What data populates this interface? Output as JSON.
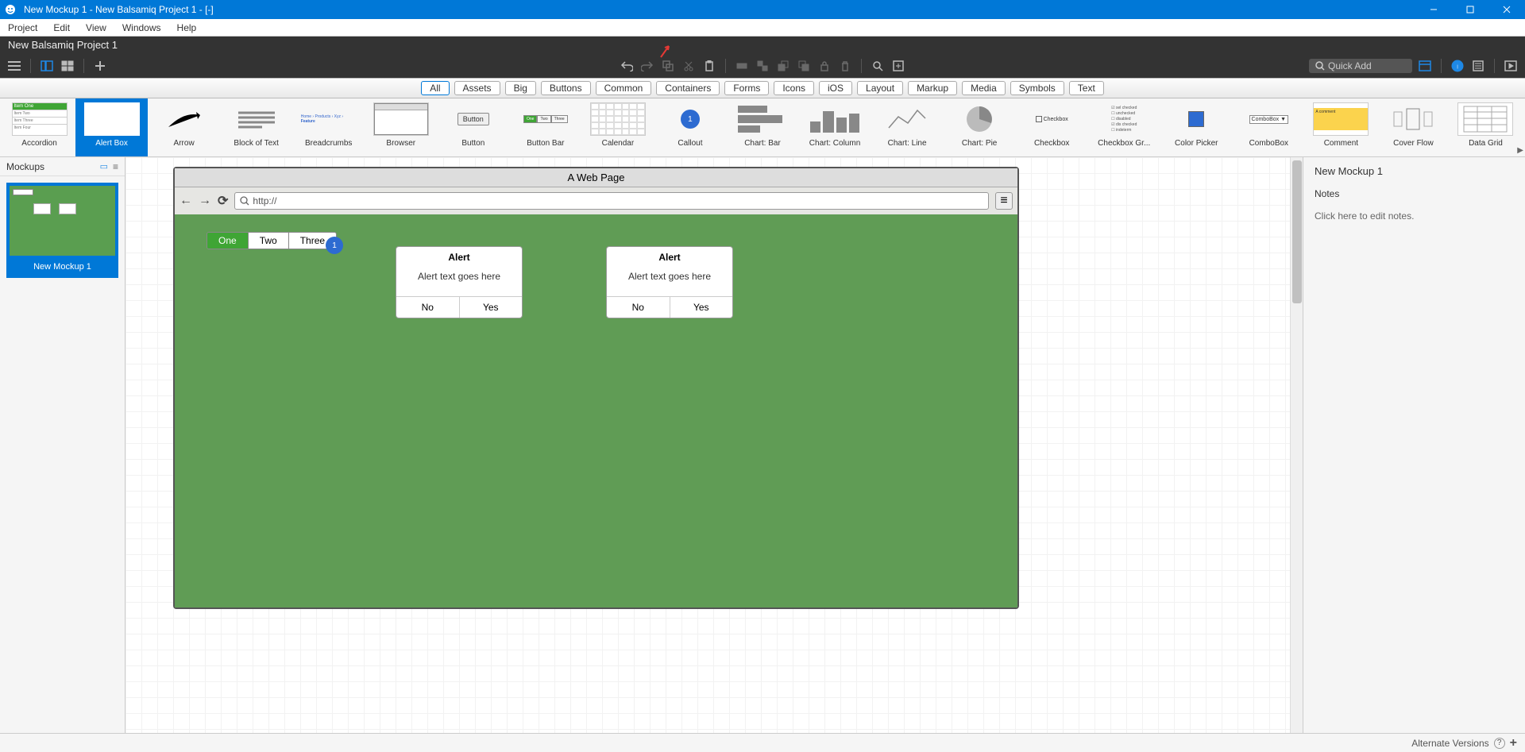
{
  "titlebar": {
    "title": "New Mockup 1 - New Balsamiq Project 1 - [-]"
  },
  "menubar": [
    "Project",
    "Edit",
    "View",
    "Windows",
    "Help"
  ],
  "project_title": "New Balsamiq Project 1",
  "quick_add_placeholder": "Quick Add",
  "filters": [
    "All",
    "Assets",
    "Big",
    "Buttons",
    "Common",
    "Containers",
    "Forms",
    "Icons",
    "iOS",
    "Layout",
    "Markup",
    "Media",
    "Symbols",
    "Text"
  ],
  "filters_active": "All",
  "ribbon": [
    {
      "label": "Accordion",
      "kind": "accordion"
    },
    {
      "label": "Alert Box",
      "kind": "alert",
      "selected": true
    },
    {
      "label": "Arrow",
      "kind": "arrow"
    },
    {
      "label": "Block of Text",
      "kind": "block"
    },
    {
      "label": "Breadcrumbs",
      "kind": "breadcrumbs"
    },
    {
      "label": "Browser",
      "kind": "browser"
    },
    {
      "label": "Button",
      "kind": "button"
    },
    {
      "label": "Button Bar",
      "kind": "buttonbar"
    },
    {
      "label": "Calendar",
      "kind": "calendar"
    },
    {
      "label": "Callout",
      "kind": "callout"
    },
    {
      "label": "Chart: Bar",
      "kind": "chartbar"
    },
    {
      "label": "Chart: Column",
      "kind": "chartcol"
    },
    {
      "label": "Chart: Line",
      "kind": "chartline"
    },
    {
      "label": "Chart: Pie",
      "kind": "chartpie"
    },
    {
      "label": "Checkbox",
      "kind": "checkbox"
    },
    {
      "label": "Checkbox Gr...",
      "kind": "checkboxgr"
    },
    {
      "label": "Color Picker",
      "kind": "colorpicker"
    },
    {
      "label": "ComboBox",
      "kind": "combo"
    },
    {
      "label": "Comment",
      "kind": "comment"
    },
    {
      "label": "Cover Flow",
      "kind": "coverflow"
    },
    {
      "label": "Data Grid",
      "kind": "datagrid"
    }
  ],
  "left_panel": {
    "title": "Mockups",
    "thumb_label": "New Mockup 1"
  },
  "canvas": {
    "browser": {
      "title": "A Web Page",
      "url": "http://",
      "buttonbar": [
        "One",
        "Two",
        "Three"
      ],
      "buttonbar_active": "One",
      "callout": "1",
      "alerts": [
        {
          "title": "Alert",
          "msg": "Alert text goes here",
          "no": "No",
          "yes": "Yes"
        },
        {
          "title": "Alert",
          "msg": "Alert text goes here",
          "no": "No",
          "yes": "Yes"
        }
      ]
    }
  },
  "right_panel": {
    "title": "New Mockup 1",
    "notes_label": "Notes",
    "notes_hint": "Click here to edit notes."
  },
  "status_bar": {
    "label": "Alternate Versions"
  }
}
